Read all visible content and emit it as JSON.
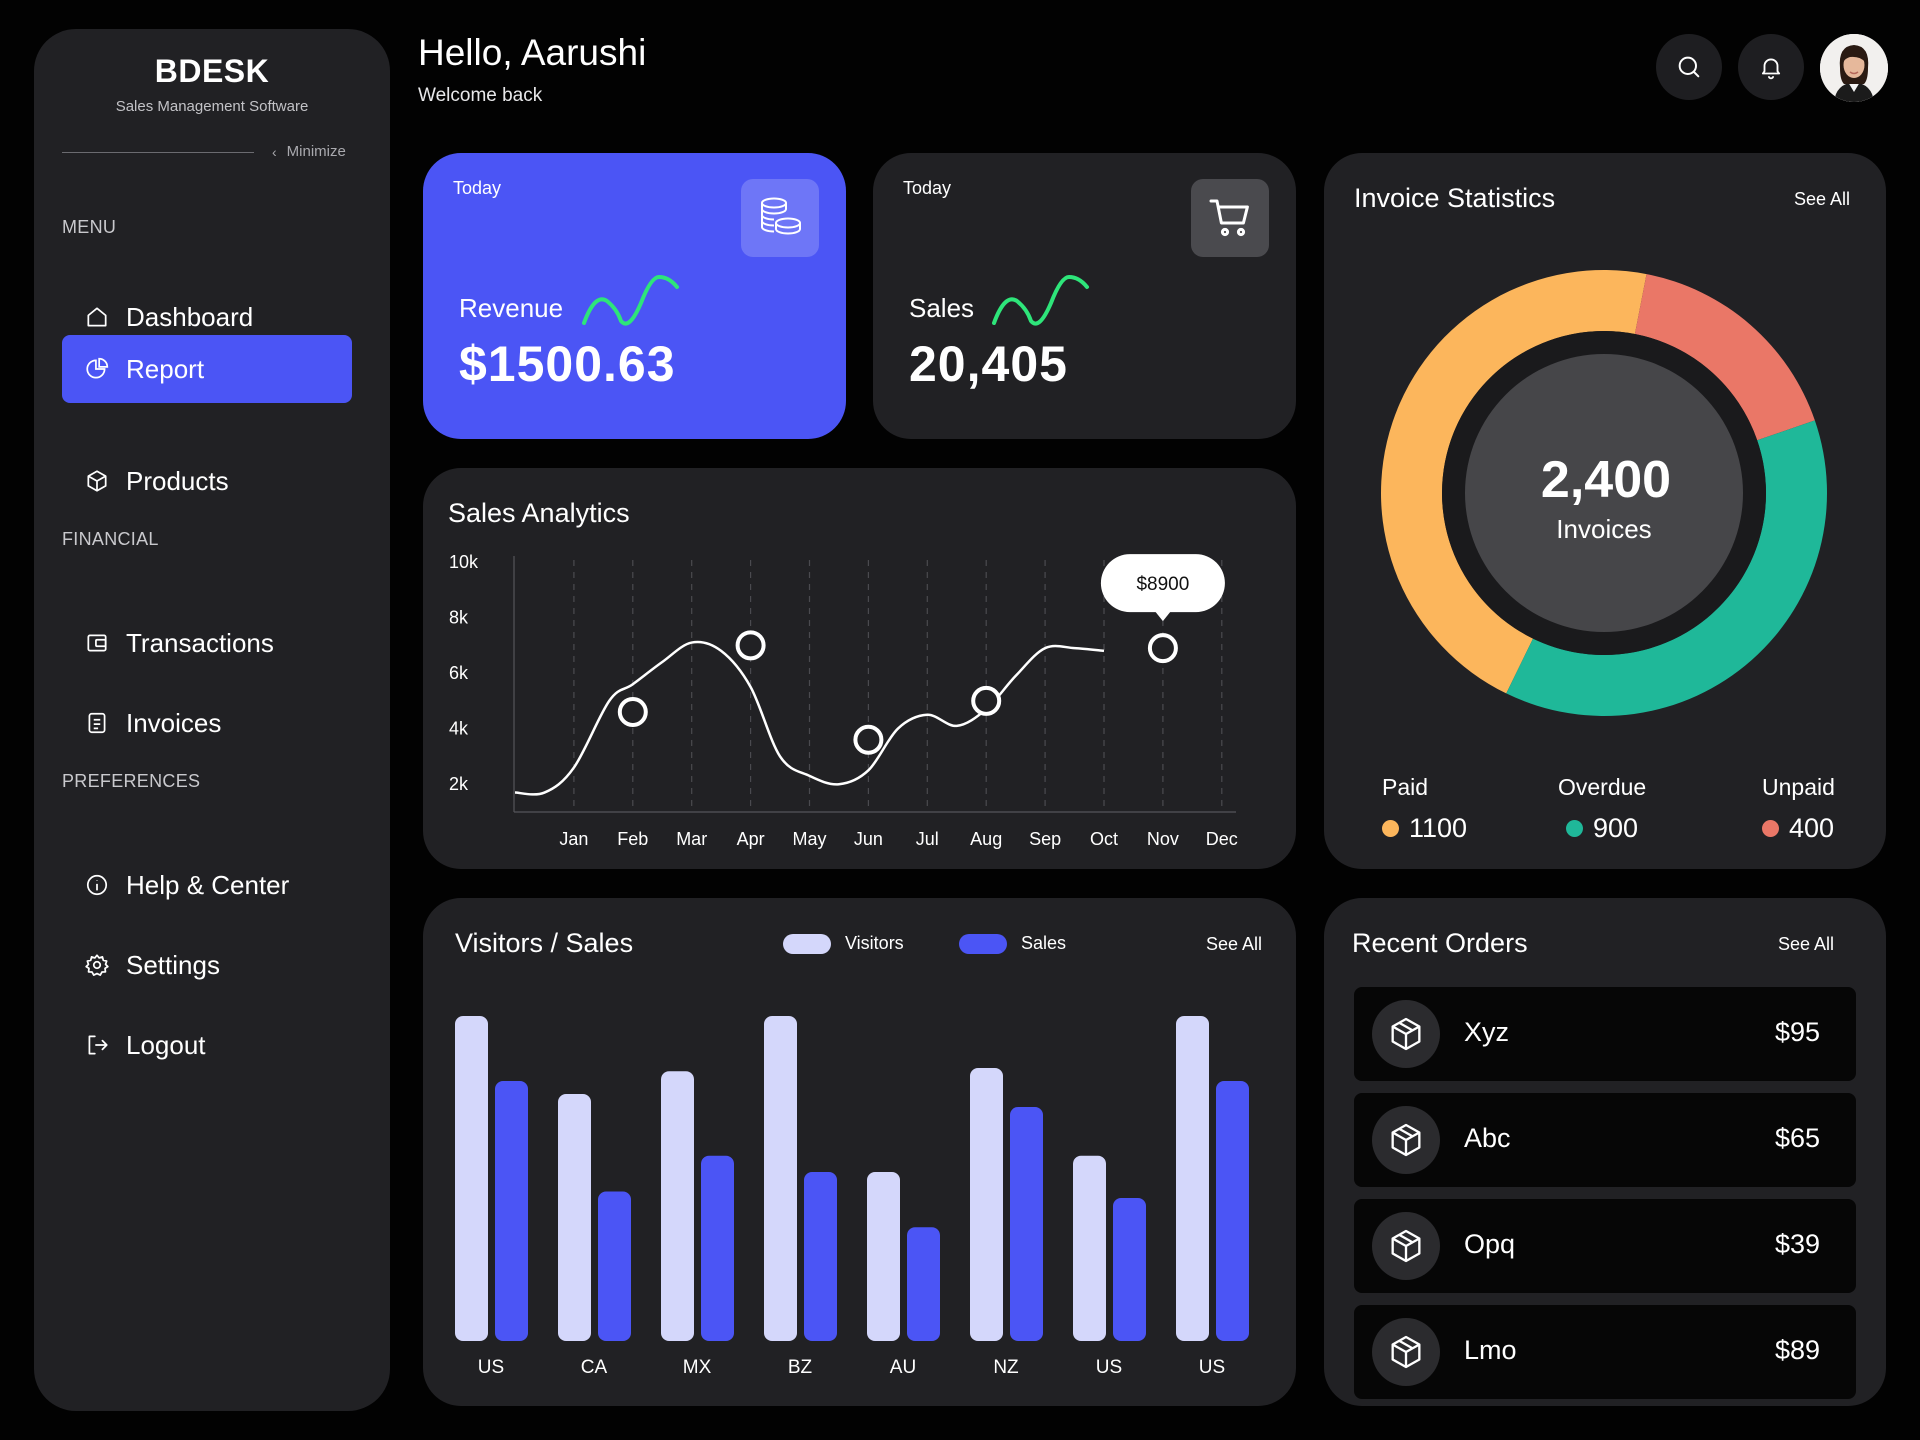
{
  "sidebar": {
    "brand": "BDESK",
    "tagline": "Sales Management Software",
    "minimize_label": "Minimize",
    "sections": {
      "menu": "MENU",
      "financial": "FINANCIAL",
      "preferences": "PREFERENCES"
    },
    "items": {
      "dashboard": "Dashboard",
      "report": "Report",
      "products": "Products",
      "transactions": "Transactions",
      "invoices": "Invoices",
      "help": "Help & Center",
      "settings": "Settings",
      "logout": "Logout"
    },
    "active_item": "report"
  },
  "header": {
    "greeting": "Hello, Aarushi",
    "subtitle": "Welcome back"
  },
  "revenue_card": {
    "period": "Today",
    "label": "Revenue",
    "value": "$1500.63",
    "icon": "coins-icon"
  },
  "sales_card": {
    "period": "Today",
    "label": "Sales",
    "value": "20,405",
    "icon": "cart-icon"
  },
  "invoice_stats": {
    "title": "Invoice Statistics",
    "see_all": "See All",
    "total": "2,400",
    "total_label": "Invoices",
    "legend": [
      {
        "key": "paid",
        "label": "Paid",
        "value": "1100",
        "color": "#fcb65c"
      },
      {
        "key": "overdue",
        "label": "Overdue",
        "value": "900",
        "color": "#1fb899"
      },
      {
        "key": "unpaid",
        "label": "Unpaid",
        "value": "400",
        "color": "#ea7767"
      }
    ]
  },
  "sales_analytics": {
    "title": "Sales Analytics",
    "tooltip": "$8900"
  },
  "visitors_sales": {
    "title": "Visitors / Sales",
    "see_all": "See All",
    "legend_visitors": "Visitors",
    "legend_sales": "Sales",
    "visitors_color": "#d4d7fb",
    "sales_color": "#4b55f5"
  },
  "recent_orders": {
    "title": "Recent Orders",
    "see_all": "See All",
    "items": [
      {
        "name": "Xyz",
        "price": "$95"
      },
      {
        "name": "Abc",
        "price": "$65"
      },
      {
        "name": "Opq",
        "price": "$39"
      },
      {
        "name": "Lmo",
        "price": "$89"
      }
    ]
  },
  "chart_data": [
    {
      "type": "line",
      "title": "Sales Analytics",
      "categories": [
        "Jan",
        "Feb",
        "Mar",
        "Apr",
        "May",
        "Jun",
        "Jul",
        "Aug",
        "Sep",
        "Oct",
        "Nov",
        "Dec"
      ],
      "yticks": [
        "10k",
        "8k",
        "6k",
        "4k",
        "2k"
      ],
      "ytick_values": [
        10000,
        8000,
        6000,
        4000,
        2000
      ],
      "ylim": [
        1000,
        10000
      ],
      "x": [
        0.5,
        1,
        1.6,
        2,
        2.5,
        3,
        3.5,
        4,
        4.5,
        5,
        5.5,
        6,
        6.5,
        7,
        7.5,
        8,
        8.5,
        9,
        9.5,
        10,
        10.5,
        11,
        11.5
      ],
      "values": [
        1700,
        2600,
        5000,
        5600,
        6400,
        7100,
        6800,
        5500,
        3000,
        2300,
        2000,
        2500,
        4000,
        4500,
        4100,
        4700,
        5900,
        6900,
        6900,
        6800
      ],
      "markers": [
        {
          "month": "Feb",
          "value": 4600
        },
        {
          "month": "Apr",
          "value": 7000
        },
        {
          "month": "Jun",
          "value": 3600
        },
        {
          "month": "Aug",
          "value": 5000
        },
        {
          "month": "Nov",
          "value": 6900
        }
      ],
      "highlight": {
        "month": "Nov",
        "label": "$8900"
      },
      "grid": "vertical-dashed"
    },
    {
      "type": "bar",
      "title": "Visitors / Sales",
      "categories": [
        "US",
        "CA",
        "MX",
        "BZ",
        "AU",
        "NZ",
        "US",
        "US"
      ],
      "series": [
        {
          "name": "Visitors",
          "values": [
            100,
            76,
            83,
            100,
            52,
            84,
            57,
            100
          ]
        },
        {
          "name": "Sales",
          "values": [
            80,
            46,
            57,
            52,
            35,
            72,
            44,
            80
          ]
        }
      ],
      "ylim": [
        0,
        100
      ]
    },
    {
      "type": "pie",
      "title": "Invoice Statistics",
      "labels": [
        "Paid",
        "Unpaid",
        "Overdue"
      ],
      "values": [
        1100,
        400,
        900
      ],
      "colors": [
        "#fcb65c",
        "#ea7767",
        "#1fb899"
      ],
      "total": 2400
    }
  ]
}
